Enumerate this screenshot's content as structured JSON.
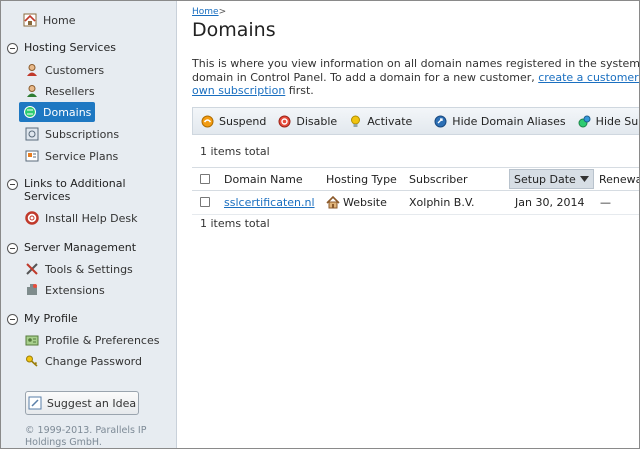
{
  "sidebar": {
    "home": "Home",
    "groups": [
      {
        "label": "Hosting Services"
      },
      {
        "label": "Links to Additional Services"
      },
      {
        "label": "Server Management"
      },
      {
        "label": "My Profile"
      }
    ],
    "hosting_items": [
      "Customers",
      "Resellers",
      "Domains",
      "Subscriptions",
      "Service Plans"
    ],
    "links_items": [
      "Install Help Desk"
    ],
    "server_items": [
      "Tools & Settings",
      "Extensions"
    ],
    "profile_items": [
      "Profile & Preferences",
      "Change Password"
    ],
    "suggest_label": "Suggest an Idea",
    "copyright": "© 1999-2013. Parallels IP Holdings GmbH."
  },
  "main": {
    "breadcrumb_home": "Home",
    "breadcrumb_sep": ">",
    "title": "Domains",
    "desc_line1": "This is where you view information on all domain names registered in the system. To add a",
    "desc_line2_a": "domain in Control Panel. To add a domain for a new customer,",
    "desc_link1": "create a customer account",
    "desc_link2": "own subscription",
    "desc_line3_b": "first.",
    "toolbar": {
      "suspend": "Suspend",
      "disable": "Disable",
      "activate": "Activate",
      "hide_aliases": "Hide Domain Aliases",
      "hide_subdomains": "Hide Subdomains"
    },
    "items_total": "1 items total",
    "columns": [
      "Domain Name",
      "Hosting Type",
      "Subscriber",
      "Setup Date",
      "Renewal"
    ],
    "rows": [
      {
        "domain": "sslcertificaten.nl",
        "hosting": "Website",
        "subscriber": "Xolphin B.V.",
        "setup": "Jan 30, 2014",
        "renewal": "—"
      }
    ]
  }
}
